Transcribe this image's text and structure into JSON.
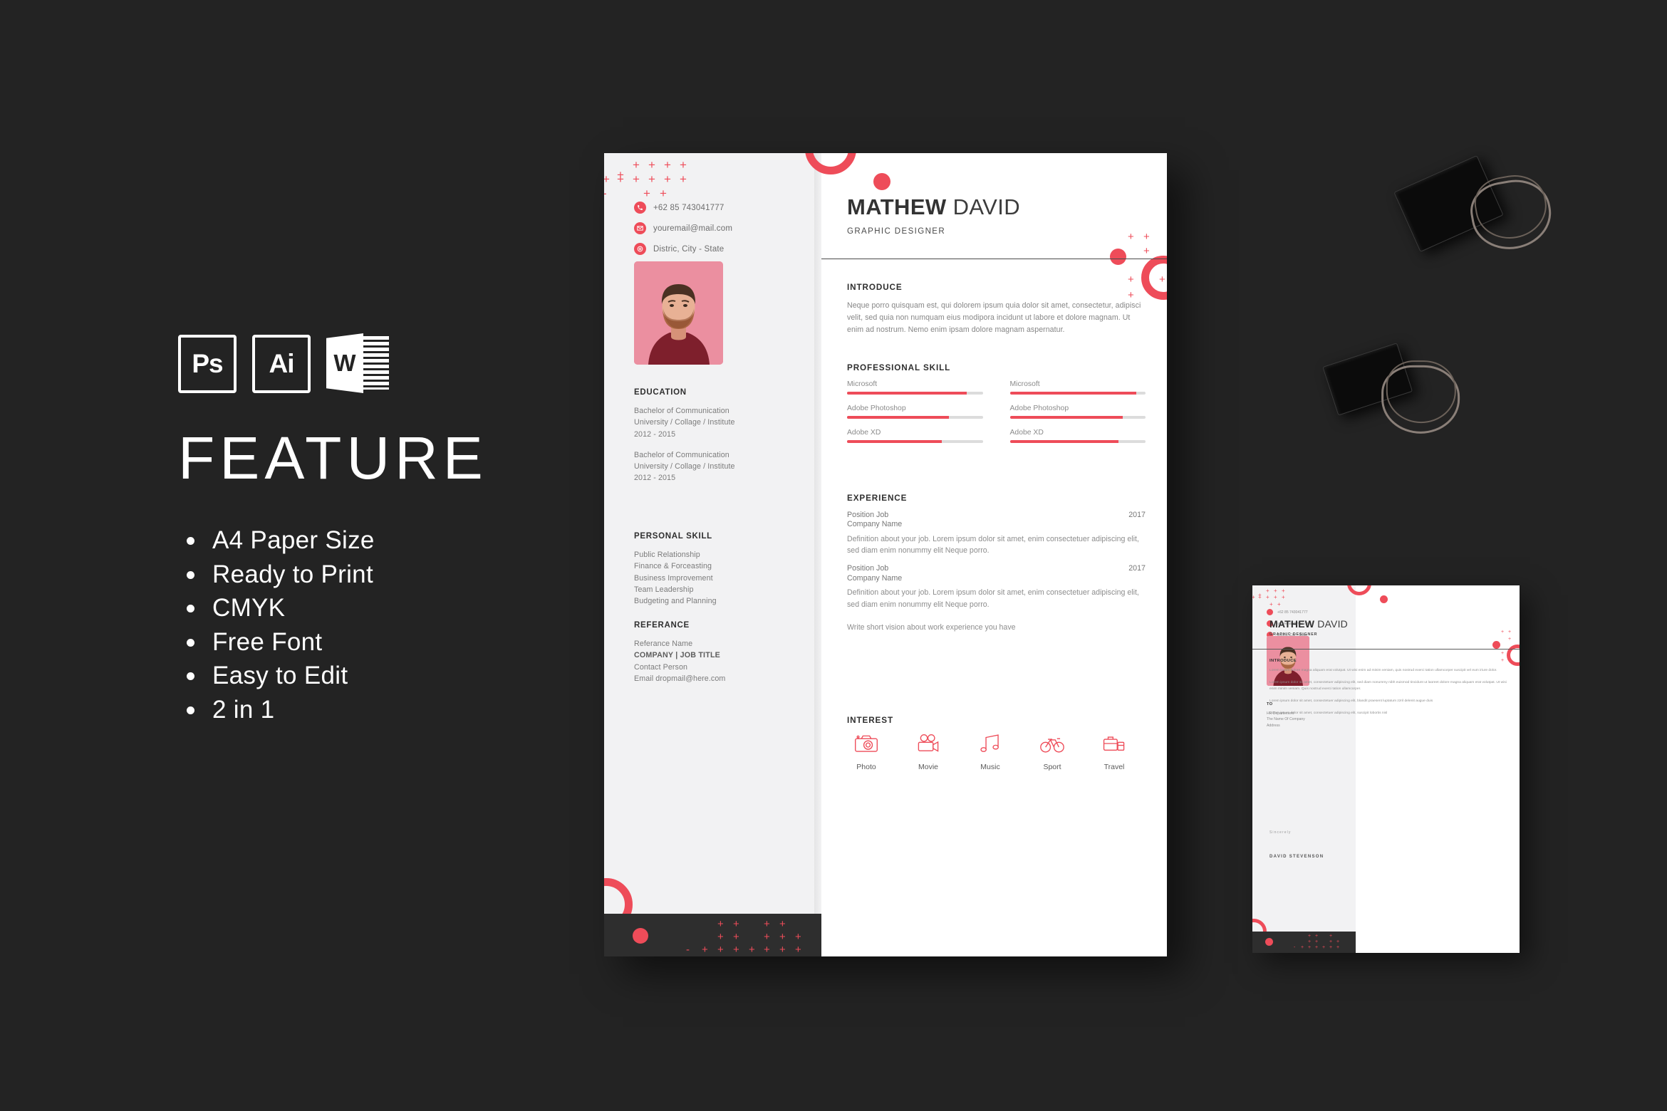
{
  "promo": {
    "badges": [
      {
        "name": "photoshop-badge",
        "label": "Ps"
      },
      {
        "name": "illustrator-badge",
        "label": "Ai"
      },
      {
        "name": "word-badge",
        "label": "W"
      }
    ],
    "heading": "FEATURE",
    "features": [
      "A4 Paper Size",
      "Ready to Print",
      "CMYK",
      "Free Font",
      "Easy to Edit",
      "2 in 1"
    ]
  },
  "colors": {
    "background": "#232323",
    "accent": "#ee4c59",
    "sidebar": "#f2f2f3",
    "photo_bg": "#eb8fa0",
    "footer_dark": "#2e2e2e",
    "bar_track": "#dcdcdc"
  },
  "resume": {
    "contact": [
      {
        "icon": "phone-icon",
        "text": "+62 85 743041777"
      },
      {
        "icon": "envelope-icon",
        "text": "youremail@mail.com"
      },
      {
        "icon": "location-pin-icon",
        "text": "Distric, City - State"
      }
    ],
    "education": {
      "title": "EDUCATION",
      "entries": [
        {
          "degree": "Bachelor of Communication",
          "school": "University / Collage / Institute",
          "years": "2012 - 2015"
        },
        {
          "degree": "Bachelor of Communication",
          "school": "University / Collage / Institute",
          "years": "2012 - 2015"
        }
      ]
    },
    "personal_skill": {
      "title": "PERSONAL SKILL",
      "items": [
        "Public Relationship",
        "Finance & Forceasting",
        "Business Improvement",
        "Team Leadership",
        "Budgeting and Planning"
      ]
    },
    "referance": {
      "title": "REFERANCE",
      "lines": [
        "Referance Name",
        "COMPANY | JOB TITLE",
        "Contact Person",
        "Email dropmail@here.com"
      ],
      "bold_index": 1
    },
    "name_bold": "MATHEW",
    "name_light": "DAVID",
    "role": "GRAPHIC DESIGNER",
    "introduce": {
      "title": "INTRODUCE",
      "body": "Neque porro quisquam est, qui dolorem ipsum quia dolor sit amet, consectetur, adipisci velit, sed quia non numquam eius modipora incidunt ut labore et dolore magnam. Ut enim ad nostrum. Nemo enim ipsam  dolore magnam  aspernatur."
    },
    "professional_skill": {
      "title": "PROFESSIONAL SKILL",
      "left": [
        {
          "label": "Microsoft",
          "value": 88
        },
        {
          "label": "Adobe Photoshop",
          "value": 75
        },
        {
          "label": "Adobe XD",
          "value": 70
        }
      ],
      "right": [
        {
          "label": "Microsoft",
          "value": 93
        },
        {
          "label": "Adobe Photoshop",
          "value": 83
        },
        {
          "label": "Adobe XD",
          "value": 80
        }
      ]
    },
    "experience": {
      "title": "EXPERIENCE",
      "items": [
        {
          "position": "Position Job",
          "company": "Company Name",
          "year": "2017",
          "description": "Definition about your job. Lorem ipsum dolor sit amet, enim consectetuer adipiscing elit, sed diam  enim nonummy elit Neque porro."
        },
        {
          "position": "Position Job",
          "company": "Company Name",
          "year": "2017",
          "description": "Definition about your job. Lorem ipsum dolor sit amet, enim consectetuer adipiscing elit, sed diam  enim nonummy elit Neque porro."
        }
      ],
      "vision": "Write short vision about work experience you have"
    },
    "interest": {
      "title": "INTEREST",
      "items": [
        {
          "icon": "camera-icon",
          "label": "Photo"
        },
        {
          "icon": "movie-camera-icon",
          "label": "Movie"
        },
        {
          "icon": "music-note-icon",
          "label": "Music"
        },
        {
          "icon": "bicycle-icon",
          "label": "Sport"
        },
        {
          "icon": "suitcase-icon",
          "label": "Travel"
        }
      ]
    }
  },
  "letter": {
    "contact": [
      {
        "icon": "phone-icon",
        "text": "+62 85 743041777"
      },
      {
        "icon": "envelope-icon",
        "text": "youremail@mail.com"
      },
      {
        "icon": "location-pin-icon",
        "text": "Distric, City - State"
      }
    ],
    "to": {
      "title": "TO",
      "lines": [
        "HR Departement",
        "The Name Of Company",
        "Address"
      ]
    },
    "name_bold": "MATHEW",
    "name_light": "DAVID",
    "role": "GRAPHIC DESIGNER",
    "introduce_title": "INTRODUCE",
    "paragraphs": [
      "Lorem ipsum dolore magna aliquam erat volutpat. Ut wisi enim ad minim veniam, quis nostrud exerci tation ullamcorper suscipit  vel eum iriure dolor.",
      "Lorem ipsum dolor sit amet, consectetuer adipiscing elit, sed diam nonummy nibh euismod tincidunt ut laoreet dolore magna aliquam erat volutpat. Ut wisi enim minim veniam. Quis nostrud exerci tation ullamcorper.",
      "Lorem ipsum dolor sit amet, consectetuer adipiscing elit, blandit praesent luptatum zzril delenit augue duis",
      "Lorem ipsum dolor sit amet, consectetuer adipiscing elit, suscipit lobortis nisl"
    ],
    "sincerely": "Sincerely",
    "signer": "DAVID STEVENSON"
  }
}
